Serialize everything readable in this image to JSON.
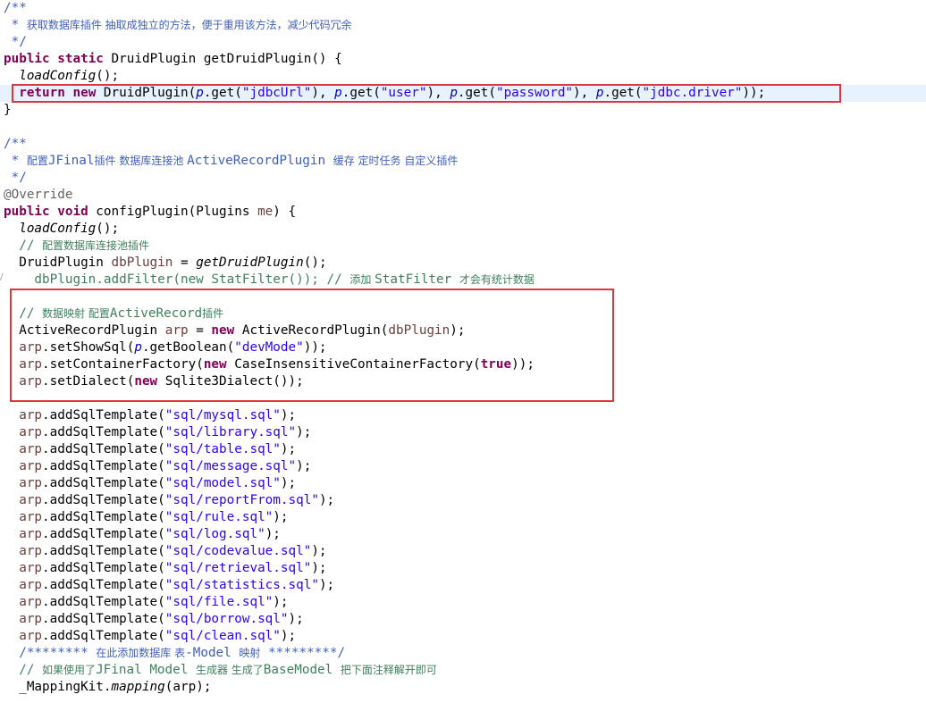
{
  "colors": {
    "keyword": "#7f0055",
    "comment": "#3f7f5f",
    "javadoc": "#3f5fbf",
    "string": "#2a00ff",
    "local_variable": "#6a3e3e",
    "annotation": "#646464",
    "highlight_box": "#e0353b",
    "current_line": "#e8f2fe"
  },
  "highlighted_lines": [
    5,
    19,
    20,
    21,
    22
  ],
  "code_lines": [
    [
      {
        "t": "/**",
        "c": "jd"
      }
    ],
    [
      {
        "t": " * ",
        "c": "jd"
      },
      {
        "t": "获取数据库插件 抽取成独立的方法，便于重用该方法，减少代码冗余",
        "c": "jd cjk"
      }
    ],
    [
      {
        "t": " */",
        "c": "jd"
      }
    ],
    [
      {
        "t": "public",
        "c": "kw"
      },
      {
        "t": " "
      },
      {
        "t": "static",
        "c": "kw"
      },
      {
        "t": " DruidPlugin getDruidPlugin() {"
      }
    ],
    [
      {
        "t": "  "
      },
      {
        "t": "loadConfig",
        "c": "it"
      },
      {
        "t": "();"
      }
    ],
    [
      {
        "t": "  "
      },
      {
        "t": "return",
        "c": "kw"
      },
      {
        "t": " "
      },
      {
        "t": "new",
        "c": "kw"
      },
      {
        "t": " DruidPlugin("
      },
      {
        "t": "p",
        "c": "fld it"
      },
      {
        "t": ".get("
      },
      {
        "t": "\"jdbcUrl\"",
        "c": "st"
      },
      {
        "t": "), "
      },
      {
        "t": "p",
        "c": "fld it"
      },
      {
        "t": ".get("
      },
      {
        "t": "\"user\"",
        "c": "st"
      },
      {
        "t": "), "
      },
      {
        "t": "p",
        "c": "fld it"
      },
      {
        "t": ".get("
      },
      {
        "t": "\"password\"",
        "c": "st"
      },
      {
        "t": "), "
      },
      {
        "t": "p",
        "c": "fld it"
      },
      {
        "t": ".get("
      },
      {
        "t": "\"jdbc.driver\"",
        "c": "st"
      },
      {
        "t": "));"
      }
    ],
    [
      {
        "t": "}"
      }
    ],
    [
      {
        "t": ""
      }
    ],
    [
      {
        "t": "/**",
        "c": "jd"
      }
    ],
    [
      {
        "t": " * ",
        "c": "jd"
      },
      {
        "t": "配置",
        "c": "jd cjk"
      },
      {
        "t": "JFinal",
        "c": "jd"
      },
      {
        "t": "插件 数据库连接池 ",
        "c": "jd cjk"
      },
      {
        "t": "ActiveRecordPlugin ",
        "c": "jd"
      },
      {
        "t": "缓存 定时任务 自定义插件",
        "c": "jd cjk"
      }
    ],
    [
      {
        "t": " */",
        "c": "jd"
      }
    ],
    [
      {
        "t": "@Override",
        "c": "ann"
      }
    ],
    [
      {
        "t": "public",
        "c": "kw"
      },
      {
        "t": " "
      },
      {
        "t": "void",
        "c": "kw"
      },
      {
        "t": " configPlugin(Plugins "
      },
      {
        "t": "me",
        "c": "var"
      },
      {
        "t": ") {"
      }
    ],
    [
      {
        "t": "  "
      },
      {
        "t": "loadConfig",
        "c": "it"
      },
      {
        "t": "();"
      }
    ],
    [
      {
        "t": "  // ",
        "c": "cm"
      },
      {
        "t": "配置数据库连接池插件",
        "c": "cm cjk"
      }
    ],
    [
      {
        "t": "  DruidPlugin "
      },
      {
        "t": "dbPlugin",
        "c": "var"
      },
      {
        "t": " = "
      },
      {
        "t": "getDruidPlugin",
        "c": "it"
      },
      {
        "t": "();"
      }
    ],
    [
      {
        "t": "    dbPlugin.addFilter(new StatFilter()); // ",
        "c": "cm"
      },
      {
        "t": "添加 ",
        "c": "cm cjk"
      },
      {
        "t": "StatFilter ",
        "c": "cm"
      },
      {
        "t": "才会有统计数据",
        "c": "cm cjk"
      }
    ],
    [
      {
        "t": ""
      }
    ],
    [
      {
        "t": "  // ",
        "c": "cm"
      },
      {
        "t": "数据映射 配置",
        "c": "cm cjk"
      },
      {
        "t": "ActiveRecord",
        "c": "cm"
      },
      {
        "t": "插件",
        "c": "cm cjk"
      }
    ],
    [
      {
        "t": "  ActiveRecordPlugin "
      },
      {
        "t": "arp",
        "c": "var"
      },
      {
        "t": " = "
      },
      {
        "t": "new",
        "c": "kw"
      },
      {
        "t": " ActiveRecordPlugin("
      },
      {
        "t": "dbPlugin",
        "c": "var"
      },
      {
        "t": ");"
      }
    ],
    [
      {
        "t": "  "
      },
      {
        "t": "arp",
        "c": "var"
      },
      {
        "t": ".setShowSql("
      },
      {
        "t": "p",
        "c": "fld it"
      },
      {
        "t": ".getBoolean("
      },
      {
        "t": "\"devMode\"",
        "c": "st"
      },
      {
        "t": "));"
      }
    ],
    [
      {
        "t": "  "
      },
      {
        "t": "arp",
        "c": "var"
      },
      {
        "t": ".setContainerFactory("
      },
      {
        "t": "new",
        "c": "kw"
      },
      {
        "t": " CaseInsensitiveContainerFactory("
      },
      {
        "t": "true",
        "c": "kw"
      },
      {
        "t": "));"
      }
    ],
    [
      {
        "t": "  "
      },
      {
        "t": "arp",
        "c": "var"
      },
      {
        "t": ".setDialect("
      },
      {
        "t": "new",
        "c": "kw"
      },
      {
        "t": " Sqlite3Dialect());"
      }
    ],
    [
      {
        "t": ""
      }
    ],
    [
      {
        "t": "  "
      },
      {
        "t": "arp",
        "c": "var"
      },
      {
        "t": ".addSqlTemplate("
      },
      {
        "t": "\"sql/mysql.sql\"",
        "c": "st"
      },
      {
        "t": ");"
      }
    ],
    [
      {
        "t": "  "
      },
      {
        "t": "arp",
        "c": "var"
      },
      {
        "t": ".addSqlTemplate("
      },
      {
        "t": "\"sql/library.sql\"",
        "c": "st"
      },
      {
        "t": ");"
      }
    ],
    [
      {
        "t": "  "
      },
      {
        "t": "arp",
        "c": "var"
      },
      {
        "t": ".addSqlTemplate("
      },
      {
        "t": "\"sql/table.sql\"",
        "c": "st"
      },
      {
        "t": ");"
      }
    ],
    [
      {
        "t": "  "
      },
      {
        "t": "arp",
        "c": "var"
      },
      {
        "t": ".addSqlTemplate("
      },
      {
        "t": "\"sql/message.sql\"",
        "c": "st"
      },
      {
        "t": ");"
      }
    ],
    [
      {
        "t": "  "
      },
      {
        "t": "arp",
        "c": "var"
      },
      {
        "t": ".addSqlTemplate("
      },
      {
        "t": "\"sql/model.sql\"",
        "c": "st"
      },
      {
        "t": ");"
      }
    ],
    [
      {
        "t": "  "
      },
      {
        "t": "arp",
        "c": "var"
      },
      {
        "t": ".addSqlTemplate("
      },
      {
        "t": "\"sql/reportFrom.sql\"",
        "c": "st"
      },
      {
        "t": ");"
      }
    ],
    [
      {
        "t": "  "
      },
      {
        "t": "arp",
        "c": "var"
      },
      {
        "t": ".addSqlTemplate("
      },
      {
        "t": "\"sql/rule.sql\"",
        "c": "st"
      },
      {
        "t": ");"
      }
    ],
    [
      {
        "t": "  "
      },
      {
        "t": "arp",
        "c": "var"
      },
      {
        "t": ".addSqlTemplate("
      },
      {
        "t": "\"sql/log.sql\"",
        "c": "st"
      },
      {
        "t": ");"
      }
    ],
    [
      {
        "t": "  "
      },
      {
        "t": "arp",
        "c": "var"
      },
      {
        "t": ".addSqlTemplate("
      },
      {
        "t": "\"sql/codevalue.sql\"",
        "c": "st"
      },
      {
        "t": ");"
      }
    ],
    [
      {
        "t": "  "
      },
      {
        "t": "arp",
        "c": "var"
      },
      {
        "t": ".addSqlTemplate("
      },
      {
        "t": "\"sql/retrieval.sql\"",
        "c": "st"
      },
      {
        "t": ");"
      }
    ],
    [
      {
        "t": "  "
      },
      {
        "t": "arp",
        "c": "var"
      },
      {
        "t": ".addSqlTemplate("
      },
      {
        "t": "\"sql/statistics.sql\"",
        "c": "st"
      },
      {
        "t": ");"
      }
    ],
    [
      {
        "t": "  "
      },
      {
        "t": "arp",
        "c": "var"
      },
      {
        "t": ".addSqlTemplate("
      },
      {
        "t": "\"sql/file.sql\"",
        "c": "st"
      },
      {
        "t": ");"
      }
    ],
    [
      {
        "t": "  "
      },
      {
        "t": "arp",
        "c": "var"
      },
      {
        "t": ".addSqlTemplate("
      },
      {
        "t": "\"sql/borrow.sql\"",
        "c": "st"
      },
      {
        "t": ");"
      }
    ],
    [
      {
        "t": "  "
      },
      {
        "t": "arp",
        "c": "var"
      },
      {
        "t": ".addSqlTemplate("
      },
      {
        "t": "\"sql/clean.sql\"",
        "c": "st"
      },
      {
        "t": ");"
      }
    ],
    [
      {
        "t": "  /******** ",
        "c": "jd"
      },
      {
        "t": "在此添加数据库 表",
        "c": "jd cjk"
      },
      {
        "t": "-Model ",
        "c": "jd"
      },
      {
        "t": "映射",
        "c": "jd cjk"
      },
      {
        "t": " *********/",
        "c": "jd"
      }
    ],
    [
      {
        "t": "  // ",
        "c": "cm"
      },
      {
        "t": "如果使用了",
        "c": "cm cjk"
      },
      {
        "t": "JFinal Model ",
        "c": "cm"
      },
      {
        "t": "生成器 生成了",
        "c": "cm cjk"
      },
      {
        "t": "BaseModel ",
        "c": "cm"
      },
      {
        "t": "把下面注释解开即可",
        "c": "cm cjk"
      }
    ],
    [
      {
        "t": "  _MappingKit."
      },
      {
        "t": "mapping",
        "c": "it"
      },
      {
        "t": "(arp);"
      }
    ]
  ]
}
